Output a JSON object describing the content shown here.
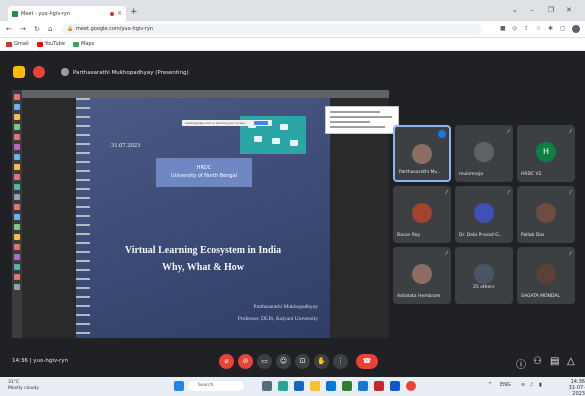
{
  "browser": {
    "tab_title": "Meet - yuo-hgiv-ryn",
    "close_glyph": "×",
    "new_tab_glyph": "+",
    "window_controls": [
      "⌄",
      "–",
      "❐",
      "✕"
    ],
    "url": "meet.google.com/yuo-hgiv-ryn",
    "bookmarks": [
      {
        "label": "Gmail",
        "color": "#d93025"
      },
      {
        "label": "YouTube",
        "color": "#ff0000"
      },
      {
        "label": "Maps",
        "color": "#34a853"
      }
    ]
  },
  "meet": {
    "presenting_label": "Parthasarathi Mukhopadhyay (Presenting)",
    "meeting_code": "14:36  |  yuo-hgiv-ryn",
    "slide": {
      "date": "31.07.2023",
      "org_line1": "HRDC",
      "org_line2": "University of North Bengal",
      "share_bar_text": "meet.google.com is sharing your screen.",
      "title_line1": "Virtual Learning Ecosystem in India",
      "title_line2": "Why, What & How",
      "presenter_name": "Parthasarathi Mukhopadhyay",
      "presenter_affil": "Professor, DLIS, Kalyani University"
    },
    "participants": [
      {
        "name": "Parthasarathi Mu..",
        "initial": "",
        "color": "#8d6e63",
        "active": true
      },
      {
        "name": "mukimroja",
        "initial": "",
        "color": "#5f6368",
        "active": false
      },
      {
        "name": "HRDC V2",
        "initial": "H",
        "color": "#0b8043",
        "active": false
      },
      {
        "name": "Barun Roy",
        "initial": "",
        "color": "#a1452f",
        "active": false
      },
      {
        "name": "Dr. Debi Prasad G..",
        "initial": "",
        "color": "#3f51b5",
        "active": false
      },
      {
        "name": "Pallab Das",
        "initial": "",
        "color": "#6d4c41",
        "active": false
      },
      {
        "name": "Ashalata Hembram",
        "initial": "",
        "color": "#8d6e63",
        "active": false
      },
      {
        "name": "25 others",
        "initial": "",
        "color": "#4a5568",
        "active": false
      },
      {
        "name": "SAGATA MONDAL",
        "initial": "",
        "color": "#5d4037",
        "active": false
      }
    ]
  },
  "taskbar": {
    "weather_temp": "31°C",
    "weather_text": "Mostly cloudy",
    "search_placeholder": "Search",
    "time": "14:36",
    "date": "31-07-2023",
    "lang": "ENG"
  },
  "colors": {
    "meet_bg": "#202124",
    "end_call": "#ea4335",
    "mic_off": "#ea4335",
    "accent": "#8ab4f8"
  }
}
